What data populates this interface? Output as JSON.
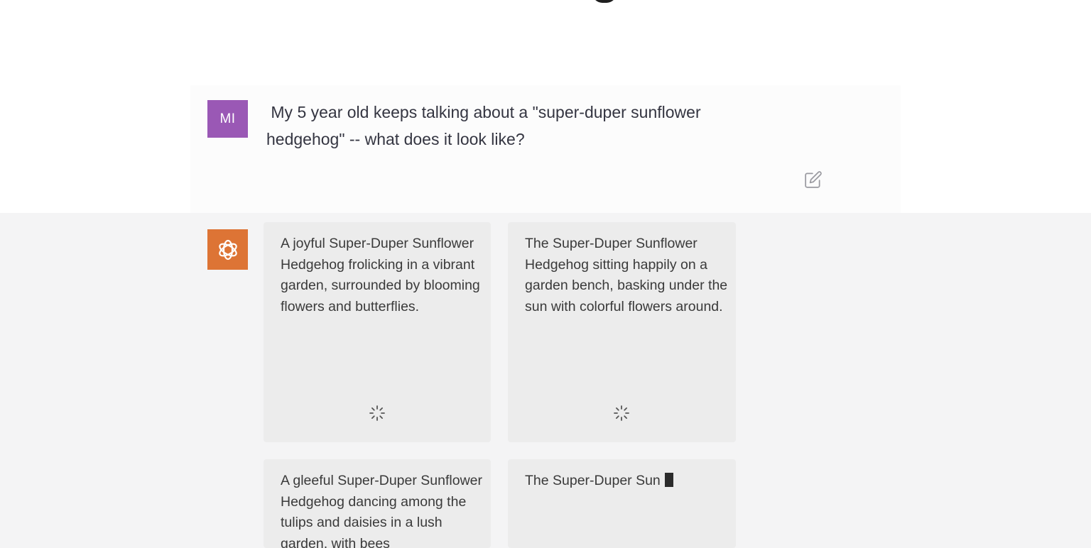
{
  "user_message": {
    "avatar_initials": "MI",
    "avatar_color": "#9a58b5",
    "text": " My 5 year old keeps talking about a \"super-duper sunflower\nhedgehog\" -- what does it look like?"
  },
  "edit_icon": "edit-icon",
  "assistant": {
    "avatar_icon": "openai-logo-icon",
    "avatar_color": "#dd7435",
    "cards": [
      {
        "caption": "A joyful Super-Duper Sunflower Hedgehog frolicking in a vibrant garden, surrounded by blooming flowers and butterflies.",
        "status_icon": "loading-spinner-icon"
      },
      {
        "caption": "The Super-Duper Sunflower Hedgehog sitting happily on a garden bench, basking under the sun with colorful flowers around.",
        "status_icon": "loading-spinner-icon"
      },
      {
        "caption": "A gleeful Super-Duper Sunflower Hedgehog dancing among the tulips and daisies in a lush garden, with bees"
      },
      {
        "caption": "The Super-Duper Sun"
      }
    ]
  },
  "colors": {
    "user_row_bg": "#ffffff",
    "assistant_row_bg": "#f4f4f5",
    "card_bg": "#ececec",
    "text": "#343541"
  }
}
